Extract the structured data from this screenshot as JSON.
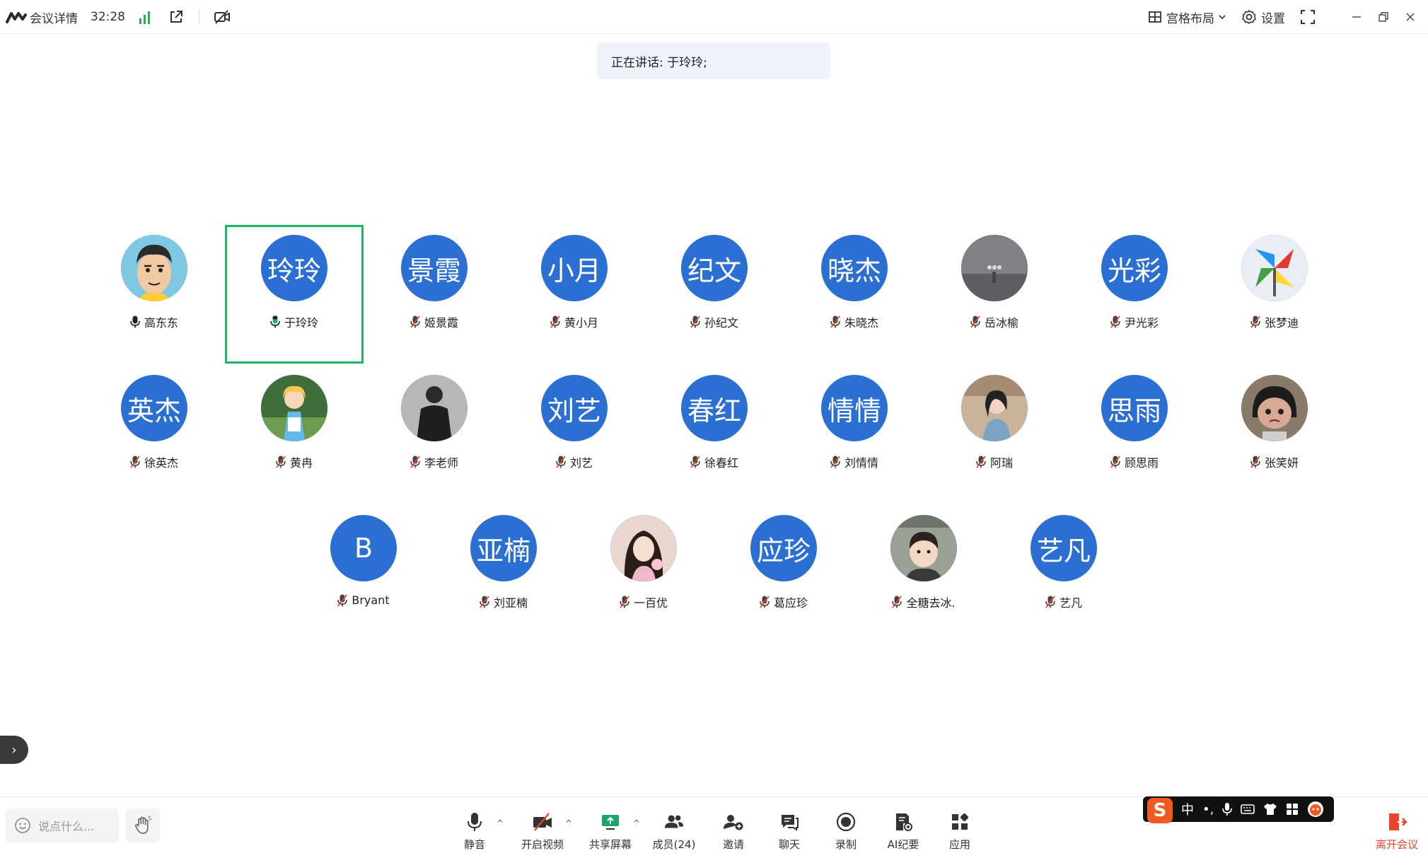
{
  "titlebar": {
    "meeting_details": "会议详情",
    "timer": "32:28",
    "layout_label": "宫格布局",
    "settings_label": "设置"
  },
  "banner": {
    "speaking": "正在讲话: 于玲玲;"
  },
  "participants": [
    {
      "avatar": "",
      "avatar_kind": "cartoon-man",
      "name": "高东东",
      "mic": "on"
    },
    {
      "avatar": "玲玲",
      "avatar_kind": "text",
      "name": "于玲玲",
      "mic": "speaking"
    },
    {
      "avatar": "景霞",
      "avatar_kind": "text",
      "name": "姬景霞",
      "mic": "muted"
    },
    {
      "avatar": "小月",
      "avatar_kind": "text",
      "name": "黄小月",
      "mic": "muted"
    },
    {
      "avatar": "纪文",
      "avatar_kind": "text",
      "name": "孙纪文",
      "mic": "muted"
    },
    {
      "avatar": "晓杰",
      "avatar_kind": "text",
      "name": "朱晓杰",
      "mic": "muted"
    },
    {
      "avatar": "",
      "avatar_kind": "photo-gray",
      "name": "岳冰榆",
      "mic": "muted"
    },
    {
      "avatar": "光彩",
      "avatar_kind": "text",
      "name": "尹光彩",
      "mic": "muted"
    },
    {
      "avatar": "",
      "avatar_kind": "pinwheel",
      "name": "张梦迪",
      "mic": "muted"
    },
    {
      "avatar": "英杰",
      "avatar_kind": "text",
      "name": "徐英杰",
      "mic": "muted"
    },
    {
      "avatar": "",
      "avatar_kind": "alice",
      "name": "黄冉",
      "mic": "muted"
    },
    {
      "avatar": "",
      "avatar_kind": "person-back",
      "name": "李老师",
      "mic": "muted"
    },
    {
      "avatar": "刘艺",
      "avatar_kind": "text",
      "name": "刘艺",
      "mic": "muted"
    },
    {
      "avatar": "春红",
      "avatar_kind": "text",
      "name": "徐春红",
      "mic": "muted"
    },
    {
      "avatar": "情情",
      "avatar_kind": "text",
      "name": "刘情情",
      "mic": "muted"
    },
    {
      "avatar": "",
      "avatar_kind": "photo-girl",
      "name": "阿瑞",
      "mic": "muted"
    },
    {
      "avatar": "思雨",
      "avatar_kind": "text",
      "name": "顾思雨",
      "mic": "muted"
    },
    {
      "avatar": "",
      "avatar_kind": "cartoon-girl",
      "name": "张笑妍",
      "mic": "muted"
    },
    {
      "avatar": "B",
      "avatar_kind": "text",
      "name": "Bryant",
      "mic": "muted"
    },
    {
      "avatar": "亚楠",
      "avatar_kind": "text",
      "name": "刘亚楠",
      "mic": "muted"
    },
    {
      "avatar": "",
      "avatar_kind": "photo-woman",
      "name": "一百优",
      "mic": "muted"
    },
    {
      "avatar": "应珍",
      "avatar_kind": "text",
      "name": "葛应珍",
      "mic": "muted"
    },
    {
      "avatar": "",
      "avatar_kind": "photo-child",
      "name": "全糖去冰.",
      "mic": "muted"
    },
    {
      "avatar": "艺凡",
      "avatar_kind": "text",
      "name": "艺凡",
      "mic": "muted"
    }
  ],
  "toolbar": {
    "chat_placeholder": "说点什么...",
    "mute": "静音",
    "video": "开启视频",
    "share": "共享屏幕",
    "members": "成员(24)",
    "invite": "邀请",
    "chat": "聊天",
    "record": "录制",
    "ai": "AI纪要",
    "apps": "应用",
    "leave": "离开会议"
  },
  "ime": {
    "logo": "S",
    "mode": "中",
    "punct": "•,"
  },
  "colors": {
    "avatar_blue": "#2b6fd3",
    "active_border": "#1db86a",
    "leave_red": "#e8452c",
    "signal_green": "#22b14c"
  }
}
